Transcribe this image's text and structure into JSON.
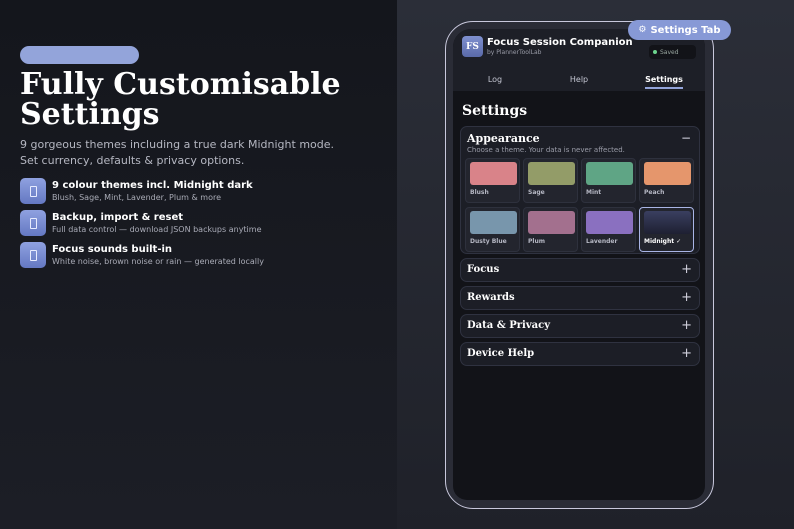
{
  "promo": {
    "headline_line1": "Fully Customisable",
    "headline_line2": "Settings",
    "subtitle": "9 gorgeous themes including a true dark Midnight mode. Set currency, defaults & privacy options.",
    "features": [
      {
        "title": "9 colour themes incl. Midnight dark",
        "desc": "Blush, Sage, Mint, Lavender, Plum & more"
      },
      {
        "title": "Backup, import & reset",
        "desc": "Full data control — download JSON backups anytime"
      },
      {
        "title": "Focus sounds built-in",
        "desc": "White noise, brown noise or rain — generated locally"
      }
    ]
  },
  "callout": {
    "icon": "⚙",
    "label": "Settings Tab"
  },
  "app": {
    "logo": "FS",
    "title": "Focus Session Companion",
    "subtitle": "by PlannerToolLab",
    "saved": "Saved",
    "tabs": [
      "Log",
      "Help",
      "Settings"
    ],
    "active_tab": "Settings",
    "page_title": "Settings",
    "appearance": {
      "title": "Appearance",
      "desc": "Choose a theme. Your data is never affected.",
      "collapse": "−",
      "themes": [
        {
          "name": "Blush",
          "color": "#d98389"
        },
        {
          "name": "Sage",
          "color": "#939c68"
        },
        {
          "name": "Mint",
          "color": "#5fa585"
        },
        {
          "name": "Peach",
          "color": "#e5966c"
        },
        {
          "name": "Dusty Blue",
          "color": "#7896ac"
        },
        {
          "name": "Plum",
          "color": "#a3708e"
        },
        {
          "name": "Lavender",
          "color": "#8a70c0"
        },
        {
          "name": "Midnight ✓",
          "color": "#2a2e48"
        }
      ]
    },
    "sections": [
      {
        "title": "Focus",
        "expand": "+"
      },
      {
        "title": "Rewards",
        "expand": "+"
      },
      {
        "title": "Data & Privacy",
        "expand": "+"
      },
      {
        "title": "Device Help",
        "expand": "+"
      }
    ]
  }
}
